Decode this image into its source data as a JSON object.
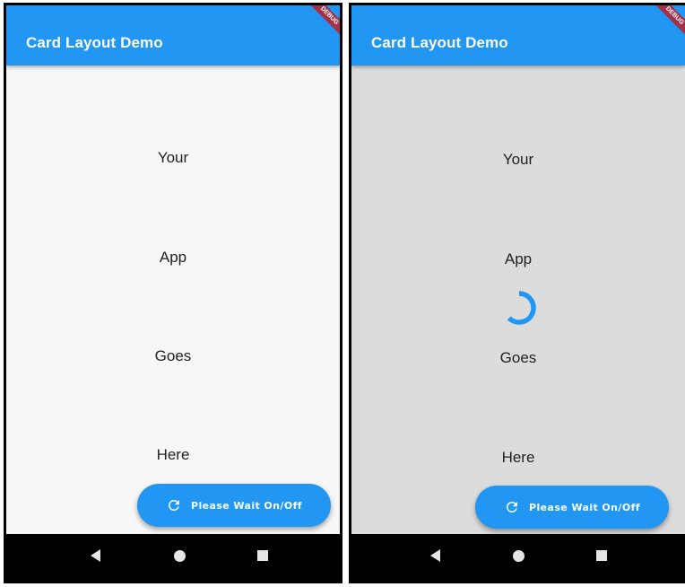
{
  "screens": [
    {
      "app_title": "Card Layout Demo",
      "debug_banner": "DEBUG",
      "words": [
        "Your",
        "App",
        "Goes",
        "Here"
      ],
      "fab_label": "Please Wait On/Off",
      "loading": false,
      "body_color": "#f7f7f7"
    },
    {
      "app_title": "Card Layout Demo",
      "debug_banner": "DEBUG",
      "words": [
        "Your",
        "App",
        "Goes",
        "Here"
      ],
      "fab_label": "Please Wait On/Off",
      "loading": true,
      "body_color": "#dcdcdc"
    }
  ],
  "colors": {
    "primary": "#2196f3",
    "debug_banner": "#a0334a",
    "nav_bar": "#000000"
  },
  "icons": {
    "fab": "refresh-icon",
    "nav": [
      "back-icon",
      "home-icon",
      "recents-icon"
    ],
    "spinner": "progress-spinner"
  }
}
